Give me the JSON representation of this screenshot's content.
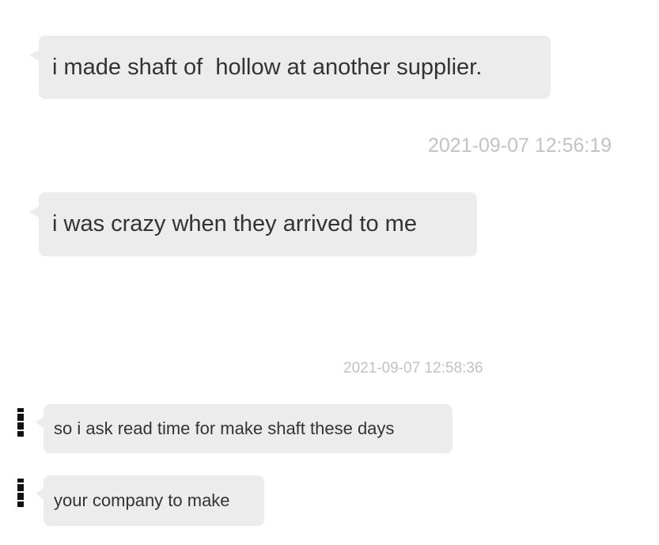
{
  "chat": {
    "messages": [
      {
        "text": "i made shaft of  hollow at another supplier."
      },
      {
        "timestamp": "2021-09-07 12:56:19"
      },
      {
        "text": "i was crazy when they arrived to me"
      },
      {
        "timestamp": "2021-09-07 12:58:36"
      },
      {
        "text": "so i ask read time for make shaft these days"
      },
      {
        "text": "your company to make"
      }
    ]
  }
}
